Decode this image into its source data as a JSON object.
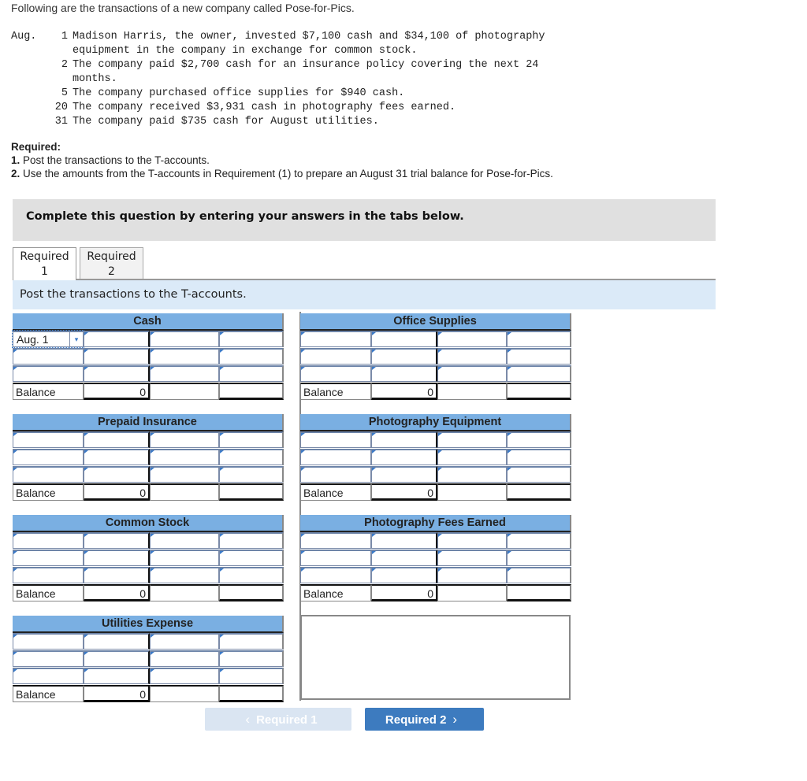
{
  "intro": "Following are the transactions of a new company called Pose-for-Pics.",
  "transactions": {
    "month": "Aug.",
    "items": [
      {
        "day": "1",
        "text": "Madison Harris, the owner, invested $7,100 cash and $34,100 of photography\nequipment in the company in exchange for common stock."
      },
      {
        "day": "2",
        "text": "The company paid $2,700 cash for an insurance policy covering the next 24\nmonths."
      },
      {
        "day": "5",
        "text": "The company purchased office supplies for $940 cash."
      },
      {
        "day": "20",
        "text": "The company received $3,931 cash in photography fees earned."
      },
      {
        "day": "31",
        "text": "The company paid $735 cash for August utilities."
      }
    ]
  },
  "required": {
    "heading": "Required:",
    "items": [
      {
        "num": "1.",
        "text": " Post the transactions to the T-accounts."
      },
      {
        "num": "2.",
        "text": " Use the amounts from the T-accounts in Requirement (1) to prepare an August 31 trial balance for Pose-for-Pics."
      }
    ]
  },
  "instructions": "Complete this question by entering your answers in the tabs below.",
  "tabs": [
    {
      "line1": "Required",
      "line2": "1",
      "active": true
    },
    {
      "line1": "Required",
      "line2": "2",
      "active": false
    }
  ],
  "sub_header": "Post the transactions to the T-accounts.",
  "taccounts": [
    {
      "title": "Cash",
      "first_date": "Aug. 1",
      "balance_label": "Balance",
      "balance_value": "0"
    },
    {
      "title": "Office Supplies",
      "balance_label": "Balance",
      "balance_value": "0"
    },
    {
      "title": "Prepaid Insurance",
      "balance_label": "Balance",
      "balance_value": "0"
    },
    {
      "title": "Photography Equipment",
      "balance_label": "Balance",
      "balance_value": "0"
    },
    {
      "title": "Common Stock",
      "balance_label": "Balance",
      "balance_value": "0"
    },
    {
      "title": "Photography Fees Earned",
      "balance_label": "Balance",
      "balance_value": "0"
    },
    {
      "title": "Utilities Expense",
      "balance_label": "Balance",
      "balance_value": "0"
    }
  ],
  "nav": {
    "prev_label": "Required 1",
    "next_label": "Required 2",
    "prev_icon": "‹",
    "next_icon": "›"
  },
  "colors": {
    "account_header": "#7aafe2",
    "sub_header_bg": "#dbeaf8",
    "instructions_bg": "#e0e0e0",
    "next_button": "#3d7bbf",
    "prev_button_disabled": "#dae5f2"
  }
}
